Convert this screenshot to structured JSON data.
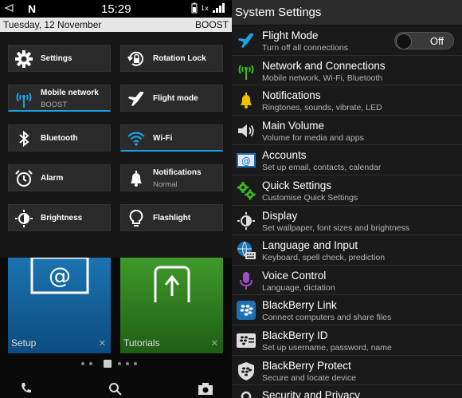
{
  "status_bar": {
    "notify_glyph": "N",
    "time": "15:29"
  },
  "date_row": {
    "date": "Tuesday, 12 November",
    "carrier": "BOOST"
  },
  "quick_settings": {
    "tiles": [
      {
        "label": "Settings",
        "sub": "",
        "icon": "gear-icon"
      },
      {
        "label": "Rotation Lock",
        "sub": "",
        "icon": "rotation-lock-icon"
      },
      {
        "label": "Mobile network",
        "sub": "BOOST",
        "icon": "antenna-icon"
      },
      {
        "label": "Flight mode",
        "sub": "",
        "icon": "airplane-icon"
      },
      {
        "label": "Bluetooth",
        "sub": "",
        "icon": "bluetooth-icon"
      },
      {
        "label": "Wi-Fi",
        "sub": "",
        "icon": "wifi-icon"
      },
      {
        "label": "Alarm",
        "sub": "",
        "icon": "alarm-clock-icon"
      },
      {
        "label": "Notifications",
        "sub": "Normal",
        "icon": "bell-icon"
      },
      {
        "label": "Brightness",
        "sub": "",
        "icon": "brightness-icon"
      },
      {
        "label": "Flashlight",
        "sub": "",
        "icon": "lightbulb-icon"
      }
    ]
  },
  "home_apps": [
    {
      "label": "Setup",
      "close": "✕"
    },
    {
      "label": "Tutorials",
      "close": "✕"
    }
  ],
  "settings": {
    "title": "System Settings",
    "items": [
      {
        "title": "Flight Mode",
        "sub": "Turn off all connections",
        "icon": "airplane-icon",
        "toggle": "Off"
      },
      {
        "title": "Network and Connections",
        "sub": "Mobile network, Wi-Fi, Bluetooth",
        "icon": "antenna-icon"
      },
      {
        "title": "Notifications",
        "sub": "Ringtones, sounds, vibrate, LED",
        "icon": "bell-icon"
      },
      {
        "title": "Main Volume",
        "sub": "Volume for media and apps",
        "icon": "speaker-icon"
      },
      {
        "title": "Accounts",
        "sub": "Set up email, contacts, calendar",
        "icon": "at-sign-icon"
      },
      {
        "title": "Quick Settings",
        "sub": "Customise Quick Settings",
        "icon": "gears-icon"
      },
      {
        "title": "Display",
        "sub": "Set wallpaper, font sizes and brightness",
        "icon": "display-icon"
      },
      {
        "title": "Language and Input",
        "sub": "Keyboard, spell check, prediction",
        "icon": "globe-keyboard-icon"
      },
      {
        "title": "Voice Control",
        "sub": "Language, dictation",
        "icon": "microphone-icon"
      },
      {
        "title": "BlackBerry Link",
        "sub": "Connect computers and share files",
        "icon": "blackberry-link-icon"
      },
      {
        "title": "BlackBerry ID",
        "sub": "Set up username, password, name",
        "icon": "blackberry-id-icon"
      },
      {
        "title": "BlackBerry Protect",
        "sub": "Secure and locate device",
        "icon": "blackberry-protect-icon"
      },
      {
        "title": "Security and Privacy",
        "sub": "",
        "icon": "lock-icon"
      }
    ]
  },
  "colors": {
    "accent": "#1aa3e0",
    "green": "#3dbb1e",
    "yellow": "#f2c200",
    "purple": "#9a4fc9",
    "tile_bg": "#2a2a2a"
  }
}
